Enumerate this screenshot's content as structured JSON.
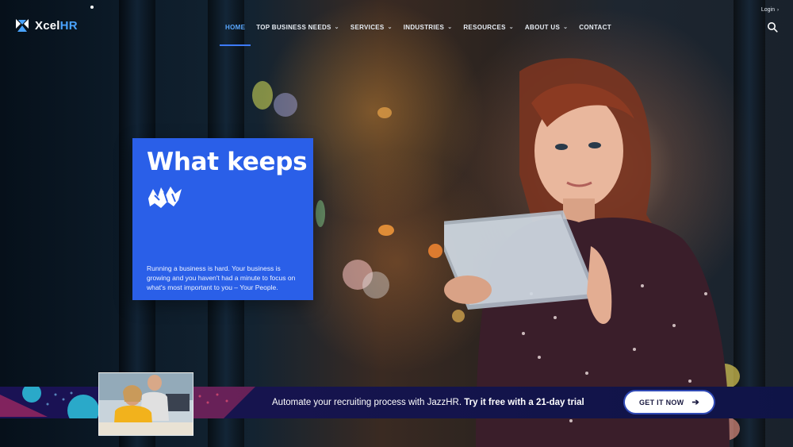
{
  "brand": {
    "name_prefix": "Xcel",
    "name_suffix": "HR"
  },
  "nav": {
    "items": [
      {
        "label": "HOME",
        "active": true,
        "has_dropdown": false
      },
      {
        "label": "TOP BUSINESS NEEDS",
        "active": false,
        "has_dropdown": true
      },
      {
        "label": "SERVICES",
        "active": false,
        "has_dropdown": true
      },
      {
        "label": "INDUSTRIES",
        "active": false,
        "has_dropdown": true
      },
      {
        "label": "RESOURCES",
        "active": false,
        "has_dropdown": true
      },
      {
        "label": "ABOUT US",
        "active": false,
        "has_dropdown": true
      },
      {
        "label": "CONTACT",
        "active": false,
        "has_dropdown": false
      }
    ],
    "login_label": "Login",
    "dropdown_glyph": "⌄",
    "login_arrow": "›"
  },
  "hero": {
    "title": "What keeps",
    "body": "Running a business is hard. Your business is growing and you haven't had a minute to focus on what's most important to you – Your People."
  },
  "banner": {
    "text_regular": "Automate your recruiting process with JazzHR. ",
    "text_bold": "Try it free with a 21-day trial",
    "cta_label": "GET IT NOW",
    "cta_arrow": "➔"
  },
  "colors": {
    "accent": "#2a5fe8",
    "nav_active": "#5aa8ff",
    "banner_bg": "#17144f"
  },
  "icons": [
    "xcelhr-logo-icon",
    "chevron-down-icon",
    "search-icon",
    "arrow-right-icon",
    "scribble-icon"
  ]
}
